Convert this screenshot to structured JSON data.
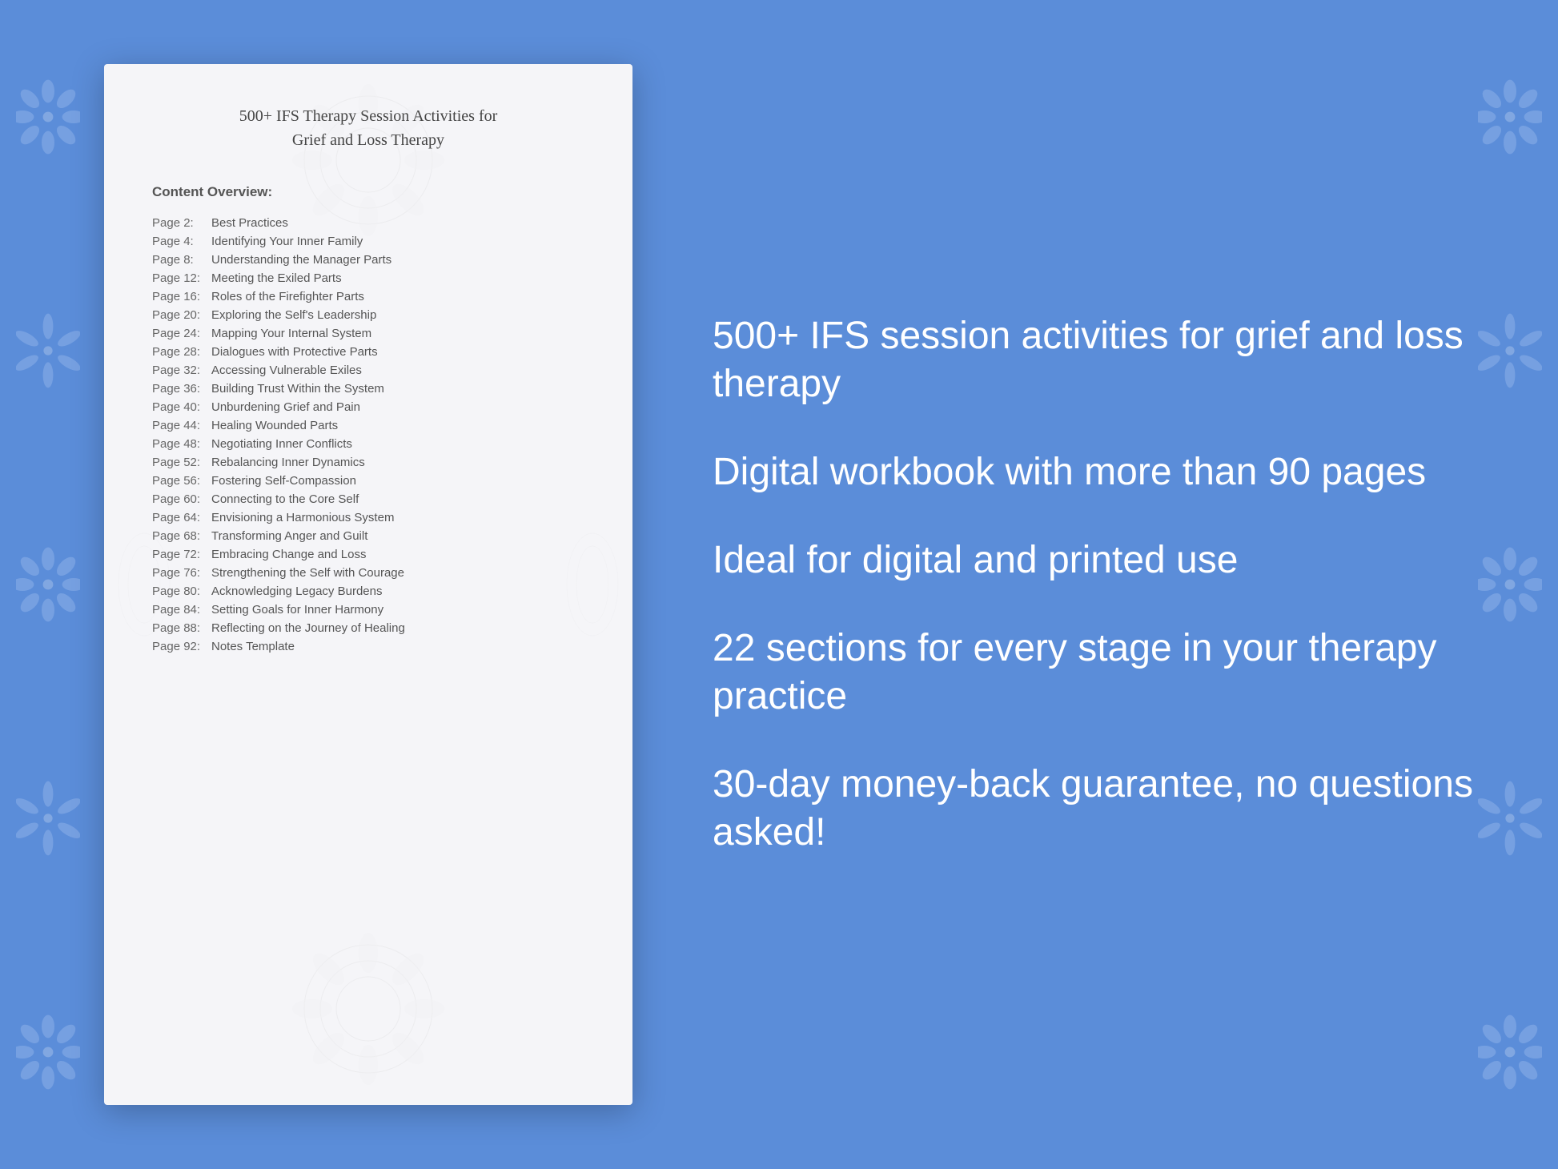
{
  "background": {
    "color": "#5b8dd9"
  },
  "document": {
    "title_line1": "500+ IFS Therapy Session Activities for",
    "title_line2": "Grief and Loss Therapy",
    "content_overview_label": "Content Overview:",
    "toc_items": [
      {
        "page": "Page  2:",
        "title": "Best Practices"
      },
      {
        "page": "Page  4:",
        "title": "Identifying Your Inner Family"
      },
      {
        "page": "Page  8:",
        "title": "Understanding the Manager Parts"
      },
      {
        "page": "Page 12:",
        "title": "Meeting the Exiled Parts"
      },
      {
        "page": "Page 16:",
        "title": "Roles of the Firefighter Parts"
      },
      {
        "page": "Page 20:",
        "title": "Exploring the Self's Leadership"
      },
      {
        "page": "Page 24:",
        "title": "Mapping Your Internal System"
      },
      {
        "page": "Page 28:",
        "title": "Dialogues with Protective Parts"
      },
      {
        "page": "Page 32:",
        "title": "Accessing Vulnerable Exiles"
      },
      {
        "page": "Page 36:",
        "title": "Building Trust Within the System"
      },
      {
        "page": "Page 40:",
        "title": "Unburdening Grief and Pain"
      },
      {
        "page": "Page 44:",
        "title": "Healing Wounded Parts"
      },
      {
        "page": "Page 48:",
        "title": "Negotiating Inner Conflicts"
      },
      {
        "page": "Page 52:",
        "title": "Rebalancing Inner Dynamics"
      },
      {
        "page": "Page 56:",
        "title": "Fostering Self-Compassion"
      },
      {
        "page": "Page 60:",
        "title": "Connecting to the Core Self"
      },
      {
        "page": "Page 64:",
        "title": "Envisioning a Harmonious System"
      },
      {
        "page": "Page 68:",
        "title": "Transforming Anger and Guilt"
      },
      {
        "page": "Page 72:",
        "title": "Embracing Change and Loss"
      },
      {
        "page": "Page 76:",
        "title": "Strengthening the Self with Courage"
      },
      {
        "page": "Page 80:",
        "title": "Acknowledging Legacy Burdens"
      },
      {
        "page": "Page 84:",
        "title": "Setting Goals for Inner Harmony"
      },
      {
        "page": "Page 88:",
        "title": "Reflecting on the Journey of Healing"
      },
      {
        "page": "Page 92:",
        "title": "Notes Template"
      }
    ]
  },
  "features": [
    "500+ IFS session activities for grief and loss therapy",
    "Digital workbook with more than 90 pages",
    "Ideal for digital and printed use",
    "22 sections for every stage in your therapy practice",
    "30-day money-back guarantee, no questions asked!"
  ]
}
